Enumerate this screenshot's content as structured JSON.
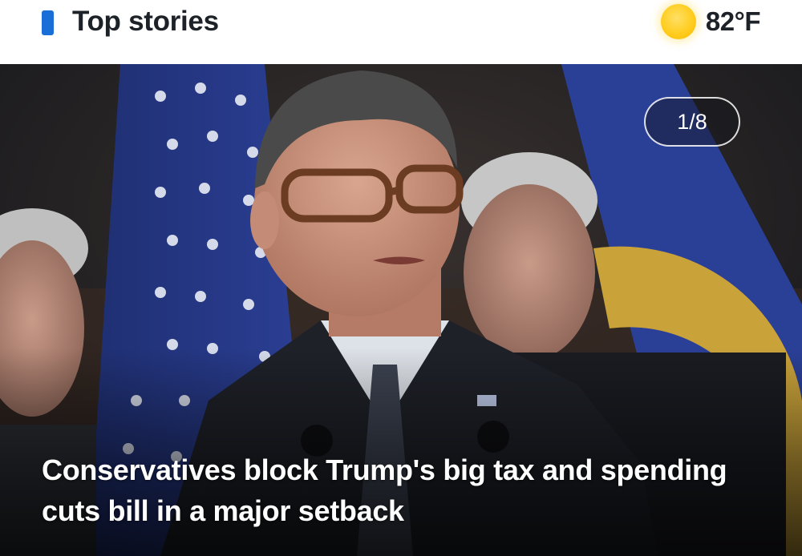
{
  "header": {
    "title": "Top stories",
    "accent_color": "#1a6ed8"
  },
  "weather": {
    "icon": "sun-icon",
    "temperature": "82",
    "unit": "°F"
  },
  "hero": {
    "counter": "1/8",
    "headline": "Conservatives block Trump's big tax and spending cuts bill in a major setback"
  }
}
